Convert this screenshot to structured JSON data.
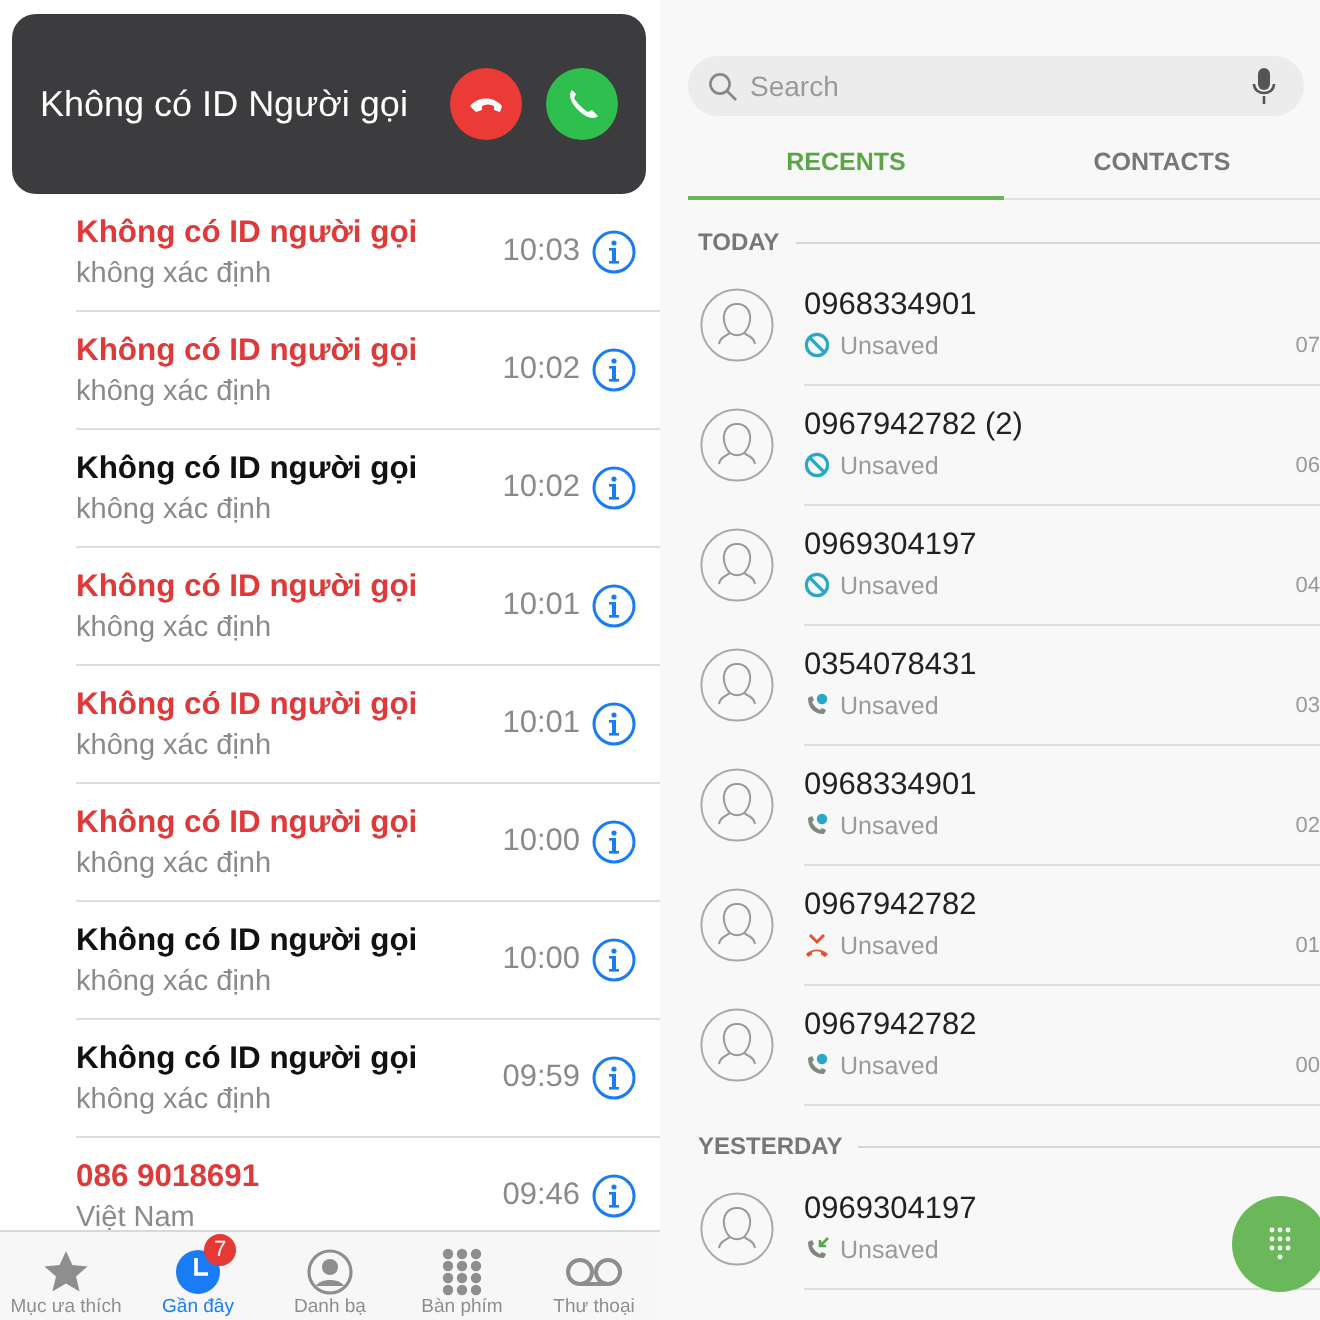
{
  "left_screen": {
    "incoming_banner": {
      "caller": "Không có ID Người gọi"
    },
    "calls": [
      {
        "name": "Không có ID người gọi",
        "detail": "không xác định",
        "time": "10:03",
        "missed": true
      },
      {
        "name": "Không có ID người gọi",
        "detail": "không xác định",
        "time": "10:02",
        "missed": true
      },
      {
        "name": "Không có ID người gọi",
        "detail": "không xác định",
        "time": "10:02",
        "missed": false
      },
      {
        "name": "Không có ID người gọi",
        "detail": "không xác định",
        "time": "10:01",
        "missed": true
      },
      {
        "name": "Không có ID người gọi",
        "detail": "không xác định",
        "time": "10:01",
        "missed": true
      },
      {
        "name": "Không có ID người gọi",
        "detail": "không xác định",
        "time": "10:00",
        "missed": true
      },
      {
        "name": "Không có ID người gọi",
        "detail": "không xác định",
        "time": "10:00",
        "missed": false
      },
      {
        "name": "Không có ID người gọi",
        "detail": "không xác định",
        "time": "09:59",
        "missed": false
      },
      {
        "name": "086 9018691",
        "detail": "Việt Nam",
        "time": "09:46",
        "missed": true
      }
    ],
    "tab_bar": [
      {
        "kind": "star",
        "label": "Mục ưa thích",
        "selected": false
      },
      {
        "kind": "clock",
        "label": "Gần đây",
        "selected": true,
        "badge": "7"
      },
      {
        "kind": "person",
        "label": "Danh bạ",
        "selected": false
      },
      {
        "kind": "keypad",
        "label": "Bàn phím",
        "selected": false
      },
      {
        "kind": "voicemail",
        "label": "Thư thoại",
        "selected": false
      }
    ]
  },
  "right_screen": {
    "search": {
      "placeholder": "Search"
    },
    "tabs": [
      {
        "label": "RECENTS",
        "selected": true
      },
      {
        "label": "CONTACTS",
        "selected": false
      }
    ],
    "sections": [
      {
        "title": "TODAY",
        "calls": [
          {
            "number": "0968334901",
            "status": "Unsaved",
            "kind": "blocked",
            "time": "07"
          },
          {
            "number": "0967942782 (2)",
            "status": "Unsaved",
            "kind": "blocked",
            "time": "06"
          },
          {
            "number": "0969304197",
            "status": "Unsaved",
            "kind": "blocked",
            "time": "04"
          },
          {
            "number": "0354078431",
            "status": "Unsaved",
            "kind": "rejected",
            "time": "03"
          },
          {
            "number": "0968334901",
            "status": "Unsaved",
            "kind": "rejected",
            "time": "02"
          },
          {
            "number": "0967942782",
            "status": "Unsaved",
            "kind": "missed",
            "time": "01"
          },
          {
            "number": "0967942782",
            "status": "Unsaved",
            "kind": "rejected",
            "time": "00"
          }
        ]
      },
      {
        "title": "YESTERDAY",
        "calls": [
          {
            "number": "0969304197",
            "status": "Unsaved",
            "kind": "incoming"
          }
        ]
      }
    ]
  }
}
